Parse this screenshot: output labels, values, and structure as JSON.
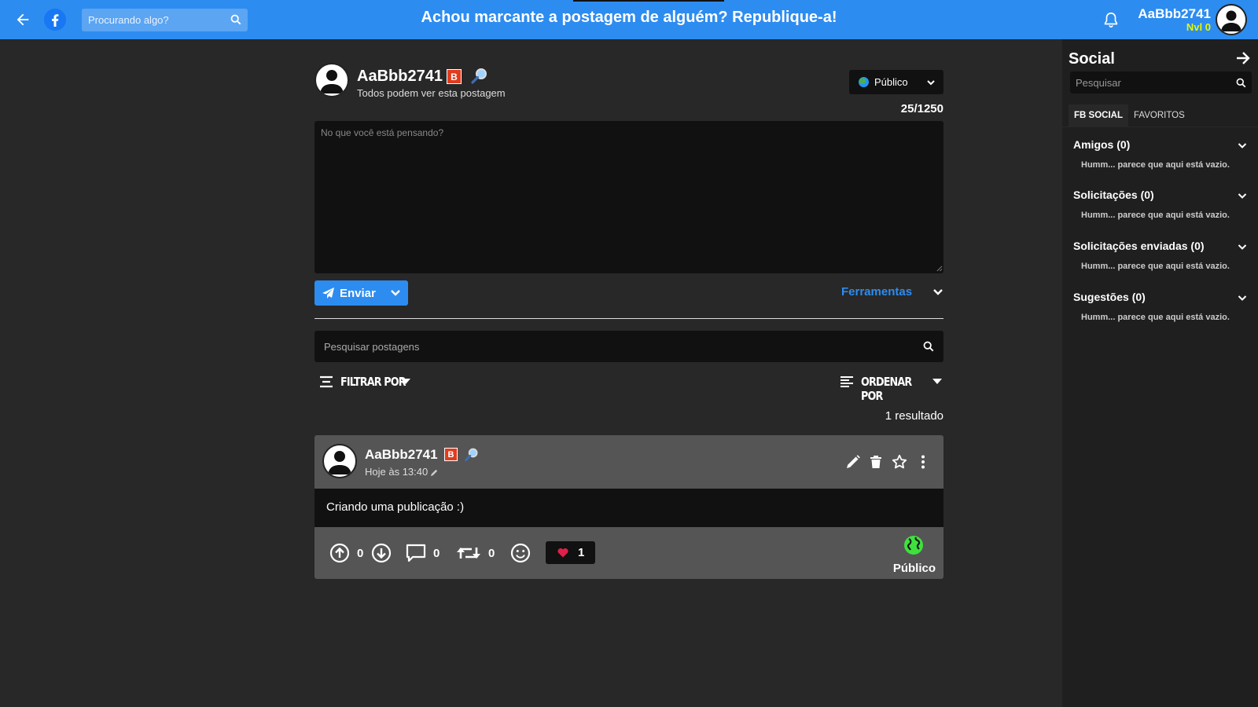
{
  "topbar": {
    "search_placeholder": "Procurando algo?",
    "headline": "Achou marcante a postagem de alguém? Republique-a!",
    "username": "AaBbb2741",
    "level": "Nvl 0",
    "accent_color": "#2d8cf0",
    "level_color": "#e5f700"
  },
  "composer": {
    "username": "AaBbb2741",
    "badge": "B",
    "subtitle": "Todos podem ver esta postagem",
    "privacy_label": "Público",
    "counter": "25/1250",
    "placeholder": "No que você está pensando?",
    "send_label": "Enviar",
    "tools_label": "Ferramentas"
  },
  "feed": {
    "search_placeholder": "Pesquisar postagens",
    "filter_label": "FILTRAR POR",
    "order_label": "ORDENAR POR",
    "results": "1 resultado"
  },
  "post": {
    "username": "AaBbb2741",
    "badge": "B",
    "time": "Hoje às 13:40",
    "text": "Criando uma publicação :)",
    "upvotes": "0",
    "downvotes_icon": "arrow-down-circle-icon",
    "comments": "0",
    "reposts": "0",
    "likes": "1",
    "privacy_label": "Público"
  },
  "social": {
    "title": "Social",
    "search_placeholder": "Pesquisar",
    "tabs": [
      "FB SOCIAL",
      "FAVORITOS"
    ],
    "groups": [
      {
        "title": "Amigos (0)",
        "empty": "Humm... parece que aqui está vazio."
      },
      {
        "title": "Solicitações (0)",
        "empty": "Humm... parece que aqui está vazio."
      },
      {
        "title": "Solicitações enviadas (0)",
        "empty": "Humm... parece que aqui está vazio."
      },
      {
        "title": "Sugestões (0)",
        "empty": "Humm... parece que aqui está vazio."
      }
    ]
  }
}
